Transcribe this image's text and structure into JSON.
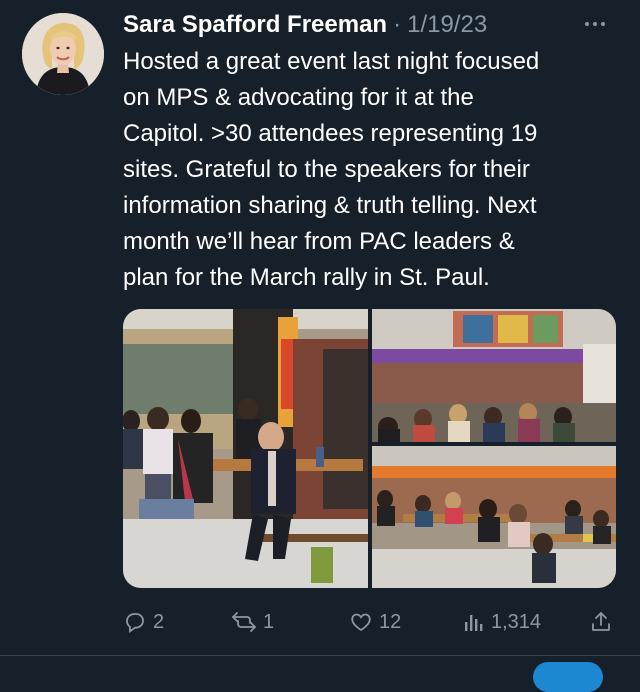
{
  "author": {
    "name": "Sara Spafford Freeman",
    "separator": "·",
    "date": "1/19/23"
  },
  "tweet_lines": [
    "Hosted a great event last night focused",
    "on MPS & advocating for it at the",
    "Capitol. >30 attendees representing 19",
    "sites. Grateful to the speakers for their",
    "information sharing & truth telling. Next",
    "month we’ll hear from PAC leaders &",
    "plan for the March rally in St. Paul."
  ],
  "actions": {
    "replies": "2",
    "retweets": "1",
    "likes": "12",
    "views": "1,314"
  },
  "icons": {
    "more": "more-horizontal-icon",
    "reply": "reply-icon",
    "retweet": "retweet-icon",
    "like": "heart-icon",
    "views": "views-icon",
    "share": "share-icon"
  },
  "colors": {
    "background": "#15202b",
    "text": "#ffffff",
    "muted": "#8b98a5",
    "divider": "#38444d"
  }
}
